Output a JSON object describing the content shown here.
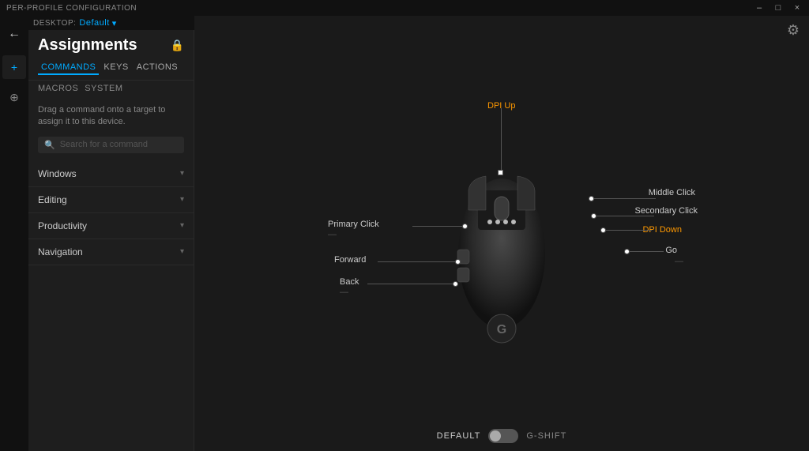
{
  "titlebar": {
    "label": "PER-PROFILE CONFIGURATION",
    "controls": [
      "–",
      "□",
      "×"
    ]
  },
  "profile": {
    "prefix": "DESKTOP:",
    "name": "Default"
  },
  "sidebar": {
    "title": "Assignments",
    "lock_icon": "🔒",
    "tabs": [
      {
        "id": "commands",
        "label": "COMMANDS",
        "active": true
      },
      {
        "id": "keys",
        "label": "KEYS",
        "active": false
      },
      {
        "id": "actions",
        "label": "ACTIONS",
        "active": false
      }
    ],
    "subtabs": [
      {
        "id": "macros",
        "label": "MACROS",
        "active": false
      },
      {
        "id": "system",
        "label": "SYSTEM",
        "active": false
      }
    ],
    "drag_hint": "Drag a command onto a target to assign it to this device.",
    "search_placeholder": "Search for a command",
    "categories": [
      {
        "label": "Windows"
      },
      {
        "label": "Editing"
      },
      {
        "label": "Productivity"
      },
      {
        "label": "Navigation"
      }
    ]
  },
  "mouse_labels": {
    "dpi_up": "DPI Up",
    "middle_click": "Middle Click",
    "secondary_click": "Secondary Click",
    "dpi_down": "DPI Down",
    "go": "Go",
    "primary_click": "Primary Click",
    "forward": "Forward",
    "back": "Back",
    "ellipsis1": "—",
    "ellipsis2": "—",
    "ellipsis3": "—"
  },
  "bottom_bar": {
    "default_label": "DEFAULT",
    "gshift_label": "G-SHIFT"
  },
  "icons": {
    "gear": "⚙",
    "back_arrow": "←",
    "plus": "+",
    "move": "⊕",
    "chevron_down": "▾",
    "search": "🔍",
    "lock": "🔒"
  },
  "colors": {
    "accent_blue": "#00aaff",
    "accent_orange": "#f90",
    "bg_dark": "#1a1a1a",
    "bg_sidebar": "#1e1e1e",
    "text_muted": "#888"
  }
}
